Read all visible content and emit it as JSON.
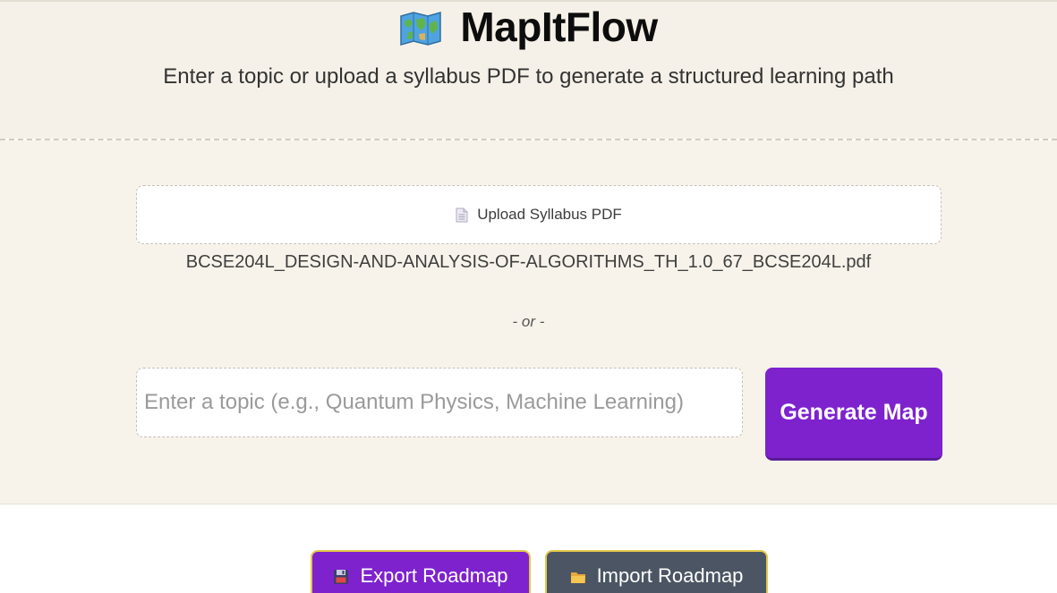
{
  "header": {
    "title": "MapItFlow",
    "icon": "world-map-icon",
    "subtitle": "Enter a topic or upload a syllabus PDF to generate a structured learning path"
  },
  "upload": {
    "icon": "document-icon",
    "label": "Upload Syllabus PDF",
    "file_name": "BCSE204L_DESIGN-AND-ANALYSIS-OF-ALGORITHMS_TH_1.0_67_BCSE204L.pdf"
  },
  "separator": "- or -",
  "topic": {
    "placeholder": "Enter a topic (e.g., Quantum Physics, Machine Learning)",
    "value": ""
  },
  "generate_button": "Generate Map",
  "export_button": {
    "icon": "floppy-disk-icon",
    "label": "Export Roadmap"
  },
  "import_button": {
    "icon": "folder-icon",
    "label": "Import Roadmap"
  },
  "colors": {
    "accent": "#7e22ce",
    "header_bg": "#f6f1e8",
    "form_bg": "#f8f3ea",
    "import_bg": "#4b5563",
    "button_border": "#e4c84a"
  }
}
